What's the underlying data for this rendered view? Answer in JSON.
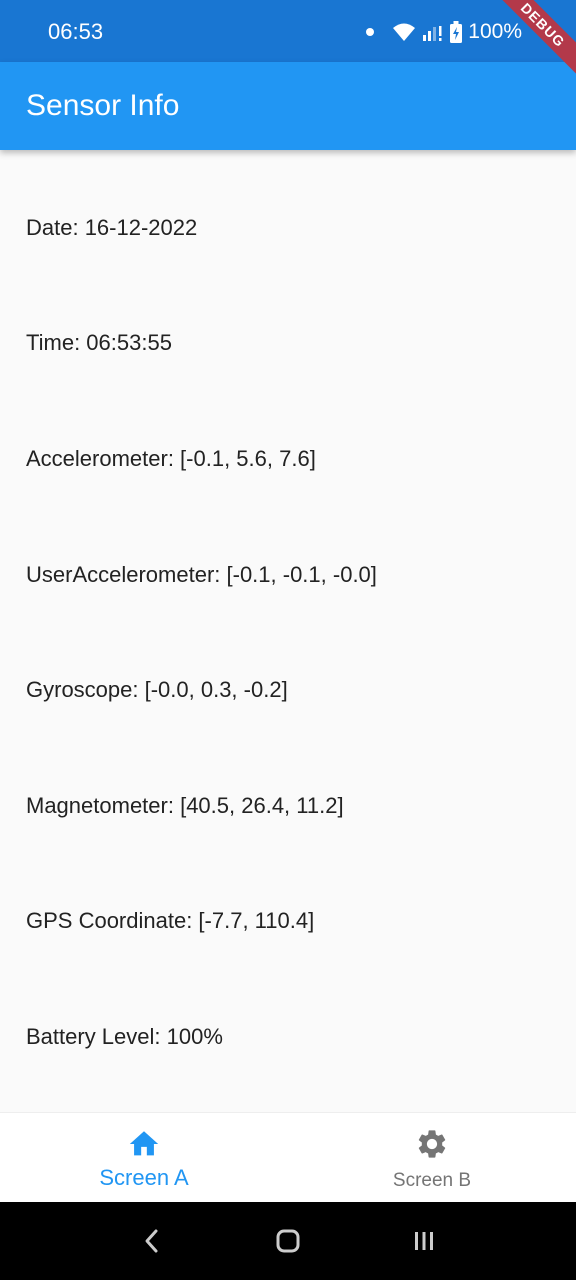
{
  "status_bar": {
    "time": "06:53",
    "battery": "100%",
    "icons": [
      "notification-dot-icon",
      "wifi-icon",
      "signal-icon",
      "battery-icon"
    ]
  },
  "debug_banner": "DEBUG",
  "app_bar": {
    "title": "Sensor Info"
  },
  "sensors": [
    {
      "text": "Date: 16-12-2022"
    },
    {
      "text": "Time: 06:53:55"
    },
    {
      "text": "Accelerometer: [-0.1, 5.6, 7.6]"
    },
    {
      "text": "UserAccelerometer: [-0.1, -0.1, -0.0]"
    },
    {
      "text": "Gyroscope: [-0.0, 0.3, -0.2]"
    },
    {
      "text": "Magnetometer: [40.5, 26.4, 11.2]"
    },
    {
      "text": "GPS Coordinate: [-7.7, 110.4]"
    },
    {
      "text": "Battery Level: 100%"
    }
  ],
  "bottom_nav": {
    "items": [
      {
        "label": "Screen A",
        "icon": "home-icon",
        "selected": true
      },
      {
        "label": "Screen B",
        "icon": "gear-icon",
        "selected": false
      }
    ]
  },
  "colors": {
    "status_bar": "#1976d2",
    "app_bar": "#2196f3",
    "selected_nav": "#2196f3",
    "unselected_nav": "#757575",
    "debug_banner": "#b3394a"
  }
}
